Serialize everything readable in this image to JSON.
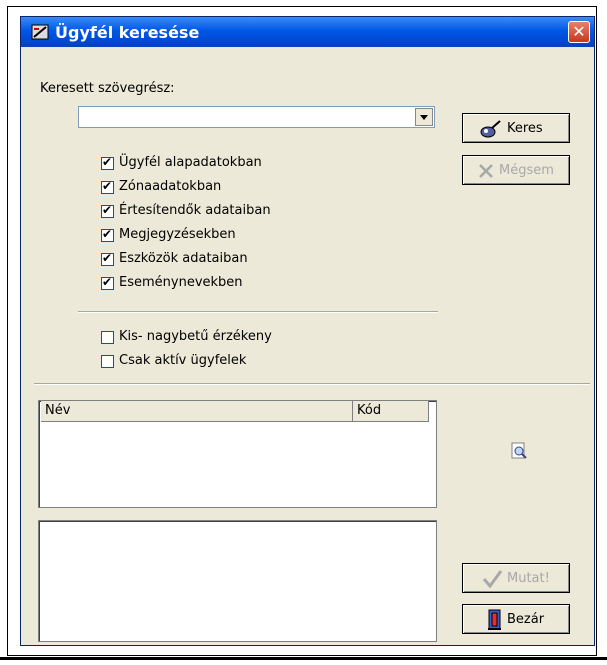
{
  "window": {
    "title": "Ügyfél keresése",
    "close_label": "✕"
  },
  "search": {
    "label": "Keresett szövegrész:",
    "value": ""
  },
  "buttons": {
    "keres": "Keres",
    "megsem": "Mégsem",
    "mutat": "Mutat!",
    "bezar": "Bezár"
  },
  "options": [
    {
      "label": "Ügyfél alapadatokban",
      "checked": true
    },
    {
      "label": "Zónaadatokban",
      "checked": true
    },
    {
      "label": "Értesítendők adataiban",
      "checked": true
    },
    {
      "label": "Megjegyzésekben",
      "checked": true
    },
    {
      "label": "Eszközök adataiban",
      "checked": true
    },
    {
      "label": "Eseménynevekben",
      "checked": true
    }
  ],
  "flags": [
    {
      "label": "Kis- nagybetű érzékeny",
      "checked": false
    },
    {
      "label": "Csak aktív ügyfelek",
      "checked": false
    }
  ],
  "results": {
    "columns": [
      "Név",
      "Kód"
    ],
    "rows": []
  },
  "colors": {
    "titlebar": "#0058e6",
    "face": "#ece9d8",
    "close": "#c4381d"
  },
  "icons": [
    "window-icon",
    "close-icon",
    "search-brush-icon",
    "cancel-x-icon",
    "magnifier-icon",
    "check-icon",
    "exit-door-icon"
  ]
}
